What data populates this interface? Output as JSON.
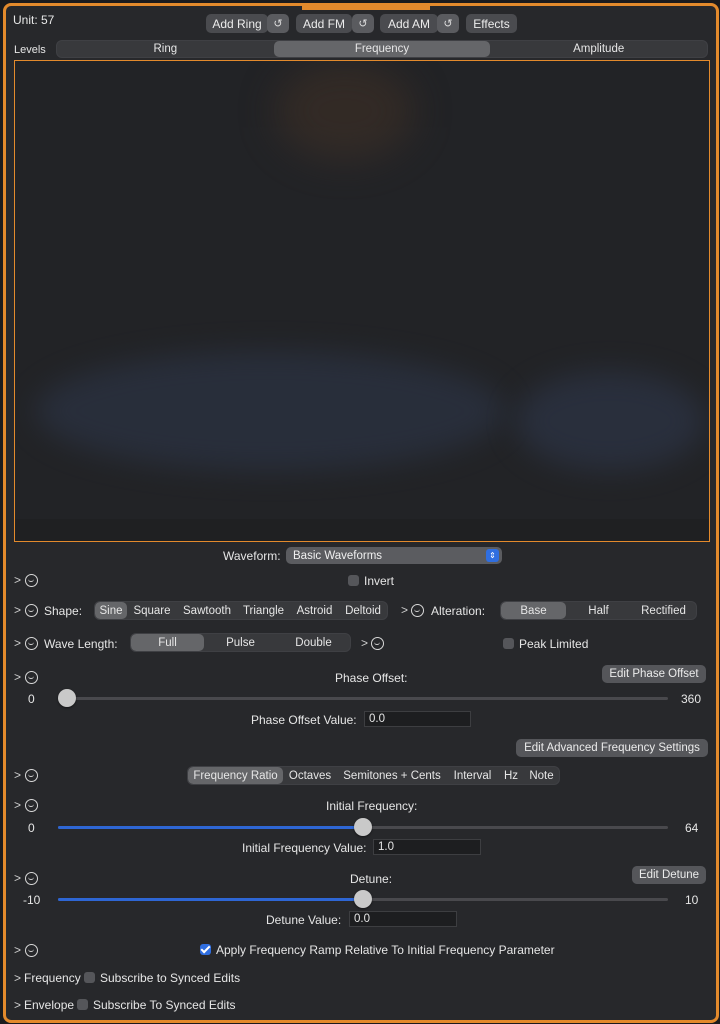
{
  "unit_label": "Unit: 57",
  "toolbar": {
    "add_ring": "Add Ring",
    "add_fm": "Add FM",
    "add_am": "Add AM",
    "effects": "Effects",
    "reset_glyph": "↺"
  },
  "levels_label": "Levels",
  "view_tabs": [
    "Ring",
    "Frequency",
    "Amplitude"
  ],
  "view_tabs_selected": "Frequency",
  "waveform": {
    "label": "Waveform:",
    "value": "Basic Waveforms"
  },
  "invert_label": "Invert",
  "shape": {
    "label": "Shape:",
    "options": [
      "Sine",
      "Square",
      "Sawtooth",
      "Triangle",
      "Astroid",
      "Deltoid"
    ],
    "selected": "Sine"
  },
  "alteration": {
    "label": "Alteration:",
    "options": [
      "Base",
      "Half",
      "Rectified"
    ],
    "selected": "Base"
  },
  "wave_length": {
    "label": "Wave Length:",
    "options": [
      "Full",
      "Pulse",
      "Double"
    ],
    "selected": "Full"
  },
  "peak_limited_label": "Peak Limited",
  "phase_offset": {
    "title": "Phase Offset:",
    "edit_button": "Edit Phase Offset",
    "min": "0",
    "max": "360",
    "value_label": "Phase Offset Value:",
    "value": "0.0",
    "position": 0.0
  },
  "advanced_button": "Edit Advanced Frequency Settings",
  "freq_mode": {
    "options": [
      "Frequency Ratio",
      "Octaves",
      "Semitones + Cents",
      "Interval",
      "Hz",
      "Note"
    ],
    "selected": "Frequency Ratio"
  },
  "initial_frequency": {
    "title": "Initial Frequency:",
    "min": "0",
    "max": "64",
    "value_label": "Initial Frequency Value:",
    "value": "1.0",
    "position": 0.5
  },
  "detune": {
    "title": "Detune:",
    "edit_button": "Edit Detune",
    "min": "-10",
    "max": "10",
    "value_label": "Detune Value:",
    "value": "0.0",
    "position": 0.5
  },
  "ramp_label": "Apply Frequency Ramp Relative To Initial Frequency Parameter",
  "frequency_row": {
    "label": "Frequency",
    "subscribe": "Subscribe to Synced Edits"
  },
  "envelope_row": {
    "label": "Envelope",
    "subscribe": "Subscribe To Synced Edits"
  },
  "chevron": ">",
  "colors": {
    "accent_orange": "#e38a2c",
    "accent_blue": "#2e66d4"
  }
}
